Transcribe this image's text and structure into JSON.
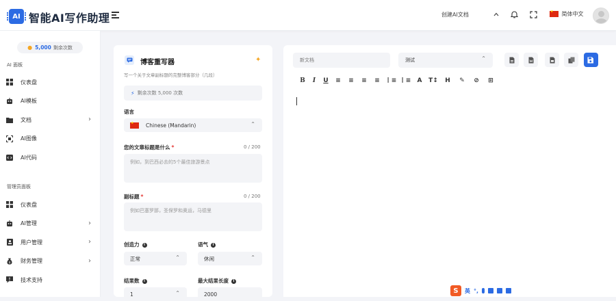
{
  "header": {
    "logo_mark": "AI",
    "app_name": "智能AI写作助理",
    "doc_select": "创建AI文档",
    "language": "简体中文"
  },
  "sidebar": {
    "credits_value": "5,000",
    "credits_label": "剩余次数",
    "section_ai": "AI 面板",
    "ai_items": [
      {
        "label": "仪表盘",
        "icon": "dashboard-icon",
        "chevron": false
      },
      {
        "label": "AI模板",
        "icon": "robot-icon",
        "chevron": false
      },
      {
        "label": "文档",
        "icon": "folder-icon",
        "chevron": true
      },
      {
        "label": "AI图像",
        "icon": "image-scan-icon",
        "chevron": false
      },
      {
        "label": "AI代码",
        "icon": "code-icon",
        "chevron": false
      }
    ],
    "section_admin": "管理员面板",
    "admin_items": [
      {
        "label": "仪表盘",
        "icon": "dashboard-icon",
        "chevron": false
      },
      {
        "label": "AI管理",
        "icon": "robot-icon",
        "chevron": true
      },
      {
        "label": "用户管理",
        "icon": "user-badge-icon",
        "chevron": true
      },
      {
        "label": "财务管理",
        "icon": "money-bag-icon",
        "chevron": true
      },
      {
        "label": "技术支持",
        "icon": "support-icon",
        "chevron": false
      }
    ]
  },
  "form": {
    "tool_title": "博客重写器",
    "tool_desc": "写一个关于文章副标题的完整博客部分（几段）",
    "remaining_text": "剩余次数 5,000 次数",
    "language_label": "语言",
    "language_value": "Chinese (Mandarin)",
    "topic_label": "您的文章标题是什么",
    "topic_counter": "0 / 200",
    "topic_placeholder": "例如，到巴西必去的5个最佳旅游景点",
    "subtitle_label": "副标题",
    "subtitle_counter": "0 / 200",
    "subtitle_placeholder": "例如巴塞罗那，圣保罗和奥运，马德里",
    "creativity_label": "创造力",
    "creativity_value": "正常",
    "tone_label": "语气",
    "tone_value": "休闲",
    "results_label": "结果数",
    "results_value": "1",
    "maxlen_label": "最大结果长度",
    "maxlen_value": "2000"
  },
  "editor": {
    "doc_name_placeholder": "新文档",
    "folder_value": "测试",
    "toolbar": [
      {
        "glyph": "B",
        "name": "bold-button"
      },
      {
        "glyph": "I",
        "name": "italic-button"
      },
      {
        "glyph": "U",
        "name": "underline-button"
      },
      {
        "glyph": "≡",
        "name": "align-left-button"
      },
      {
        "glyph": "≡",
        "name": "align-center-button"
      },
      {
        "glyph": "≡",
        "name": "align-right-button"
      },
      {
        "glyph": "≡",
        "name": "align-justify-button"
      },
      {
        "glyph": "⋮≡",
        "name": "ordered-list-button"
      },
      {
        "glyph": "⋮≡",
        "name": "bullet-list-button"
      },
      {
        "glyph": "A",
        "name": "font-color-button"
      },
      {
        "glyph": "T↕",
        "name": "font-size-button"
      },
      {
        "glyph": "H",
        "name": "heading-button"
      },
      {
        "glyph": "✎",
        "name": "brush-button"
      },
      {
        "glyph": "⊘",
        "name": "link-button"
      },
      {
        "glyph": "⊞",
        "name": "table-button"
      }
    ]
  },
  "ime": {
    "mode": "英"
  },
  "colors": {
    "accent": "#2c6be3",
    "required": "#e53935",
    "coin": "#f5a623"
  }
}
